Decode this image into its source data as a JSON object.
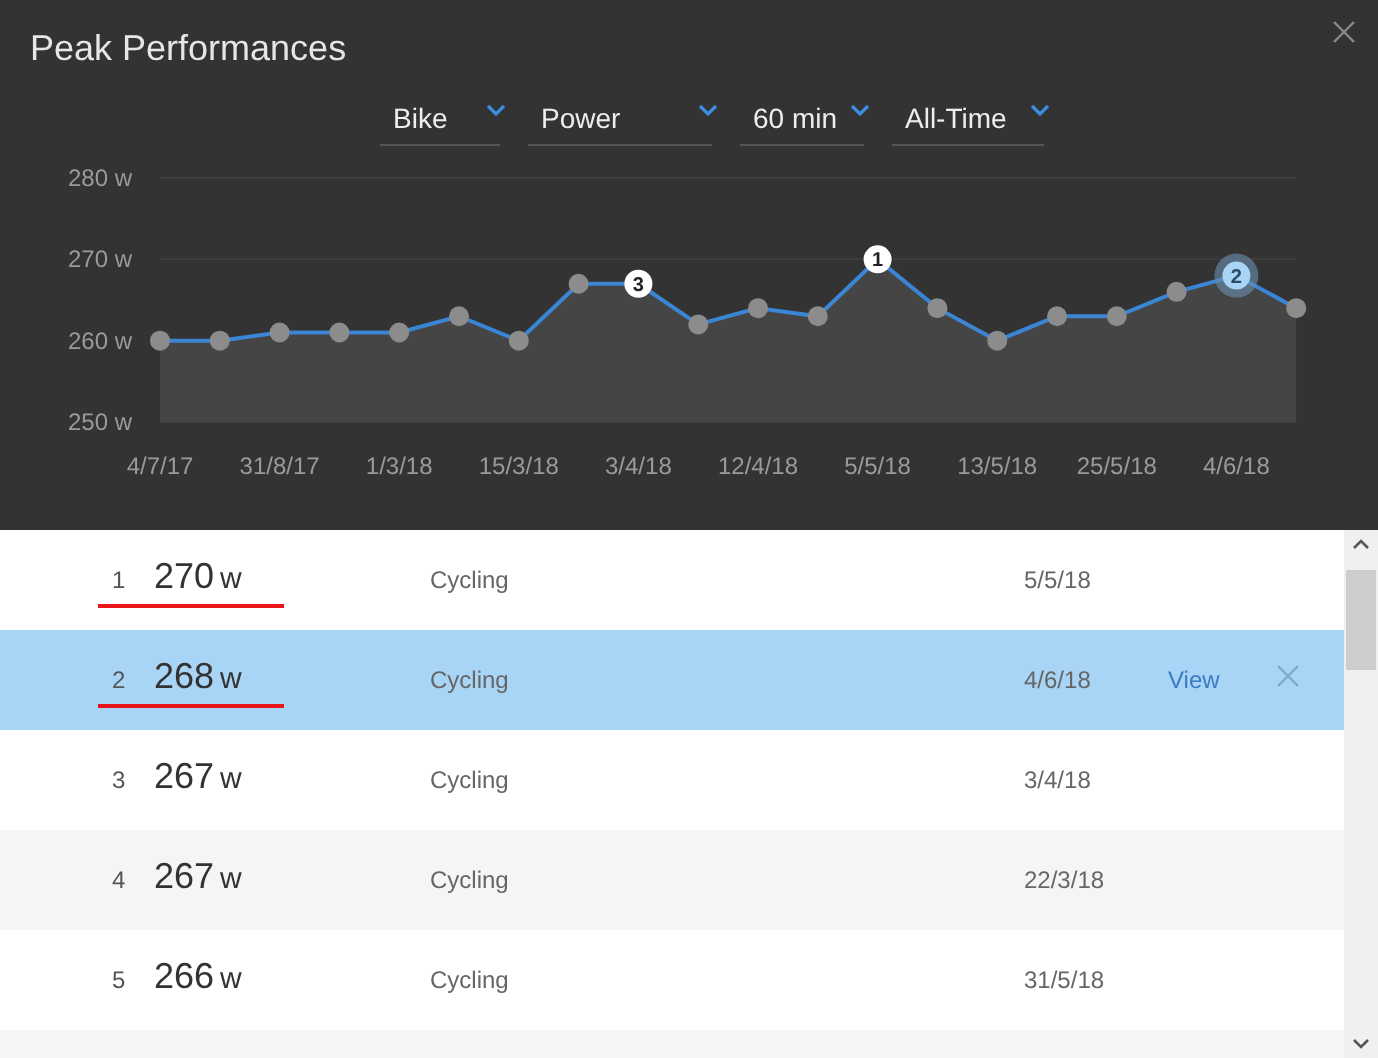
{
  "window": {
    "title": "Peak Performances"
  },
  "filters": [
    {
      "label": "Bike"
    },
    {
      "label": "Power"
    },
    {
      "label": "60 min"
    },
    {
      "label": "All-Time"
    }
  ],
  "chart_data": {
    "type": "area",
    "categories": [
      "4/7/17",
      null,
      "31/8/17",
      null,
      "1/3/18",
      null,
      "15/3/18",
      null,
      "3/4/18",
      null,
      "12/4/18",
      null,
      "5/5/18",
      null,
      "13/5/18",
      null,
      "25/5/18",
      null,
      "4/6/18",
      null
    ],
    "series": [
      {
        "color": "#3a86d4",
        "values": [
          260,
          260,
          261,
          261,
          261,
          263,
          260,
          267,
          267,
          262,
          264,
          263,
          270,
          264,
          260,
          263,
          263,
          266,
          268,
          264
        ]
      }
    ],
    "ylim": [
      250,
      280
    ],
    "yticks": [
      {
        "value": 250,
        "label": "250 w"
      },
      {
        "value": 260,
        "label": "260 w"
      },
      {
        "value": 270,
        "label": "270 w"
      },
      {
        "value": 280,
        "label": "280 w"
      }
    ],
    "annotations": [
      {
        "x": "3/4/18",
        "y": 267,
        "text": "3"
      },
      {
        "x": "5/5/18",
        "y": 270,
        "text": "1"
      },
      {
        "x": "4/6/18",
        "y": 268,
        "text": "2"
      }
    ]
  },
  "chart_markers": [
    {
      "selected": false
    },
    {
      "selected": false
    },
    {
      "selected": true
    }
  ],
  "rows": [
    {
      "rank": "1",
      "value": "270",
      "unit": "w",
      "sport": "Cycling",
      "date": "5/5/18",
      "selected": false,
      "underlined": true
    },
    {
      "rank": "2",
      "value": "268",
      "unit": "w",
      "sport": "Cycling",
      "date": "4/6/18",
      "selected": true,
      "underlined": true,
      "action": "View"
    },
    {
      "rank": "3",
      "value": "267",
      "unit": "w",
      "sport": "Cycling",
      "date": "3/4/18",
      "selected": false,
      "underlined": false
    },
    {
      "rank": "4",
      "value": "267",
      "unit": "w",
      "sport": "Cycling",
      "date": "22/3/18",
      "selected": false,
      "underlined": false
    },
    {
      "rank": "5",
      "value": "266",
      "unit": "w",
      "sport": "Cycling",
      "date": "31/5/18",
      "selected": false,
      "underlined": false
    }
  ]
}
